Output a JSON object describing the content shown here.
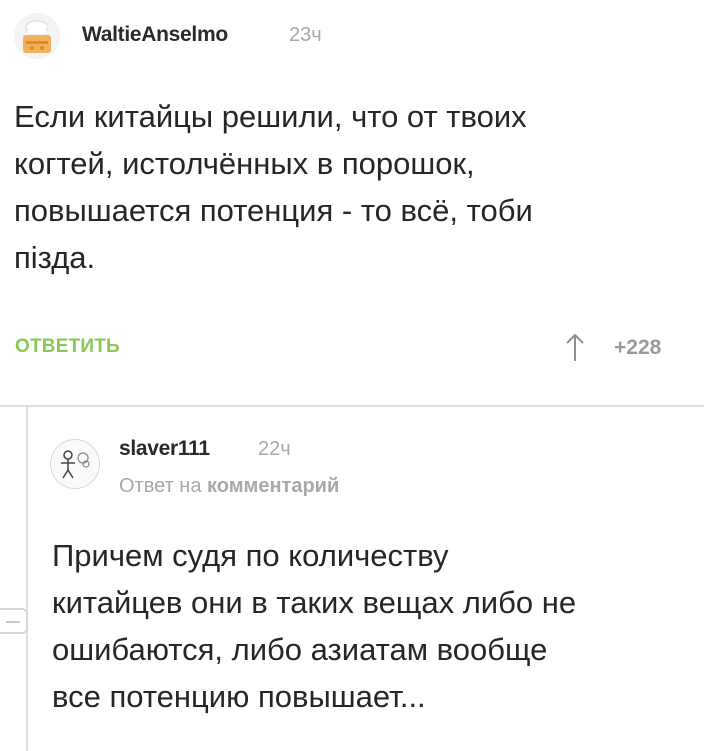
{
  "comment1": {
    "author": "WaltieAnselmo",
    "time": "23ч",
    "lines": [
      "Если китайцы решили, что от твоих",
      "когтей, истолчённых в порошок,",
      "повышается потенция - то всё, тоби",
      "пiзда."
    ],
    "reply_label": "ОТВЕТИТЬ",
    "rating": "+228",
    "upvote_icon": "arrow-up-icon"
  },
  "comment2": {
    "author": "slaver111",
    "time": "22ч",
    "reply_to_prefix": "Ответ на",
    "reply_to_link": "комментарий",
    "lines": [
      "Причем судя по количеству",
      "китайцев они в таких вещах либо не",
      "ошибаются, либо азиатам вообще",
      "все потенцию повышает..."
    ]
  },
  "colors": {
    "reply_green": "#8ac858",
    "muted": "#a8a8a8"
  }
}
